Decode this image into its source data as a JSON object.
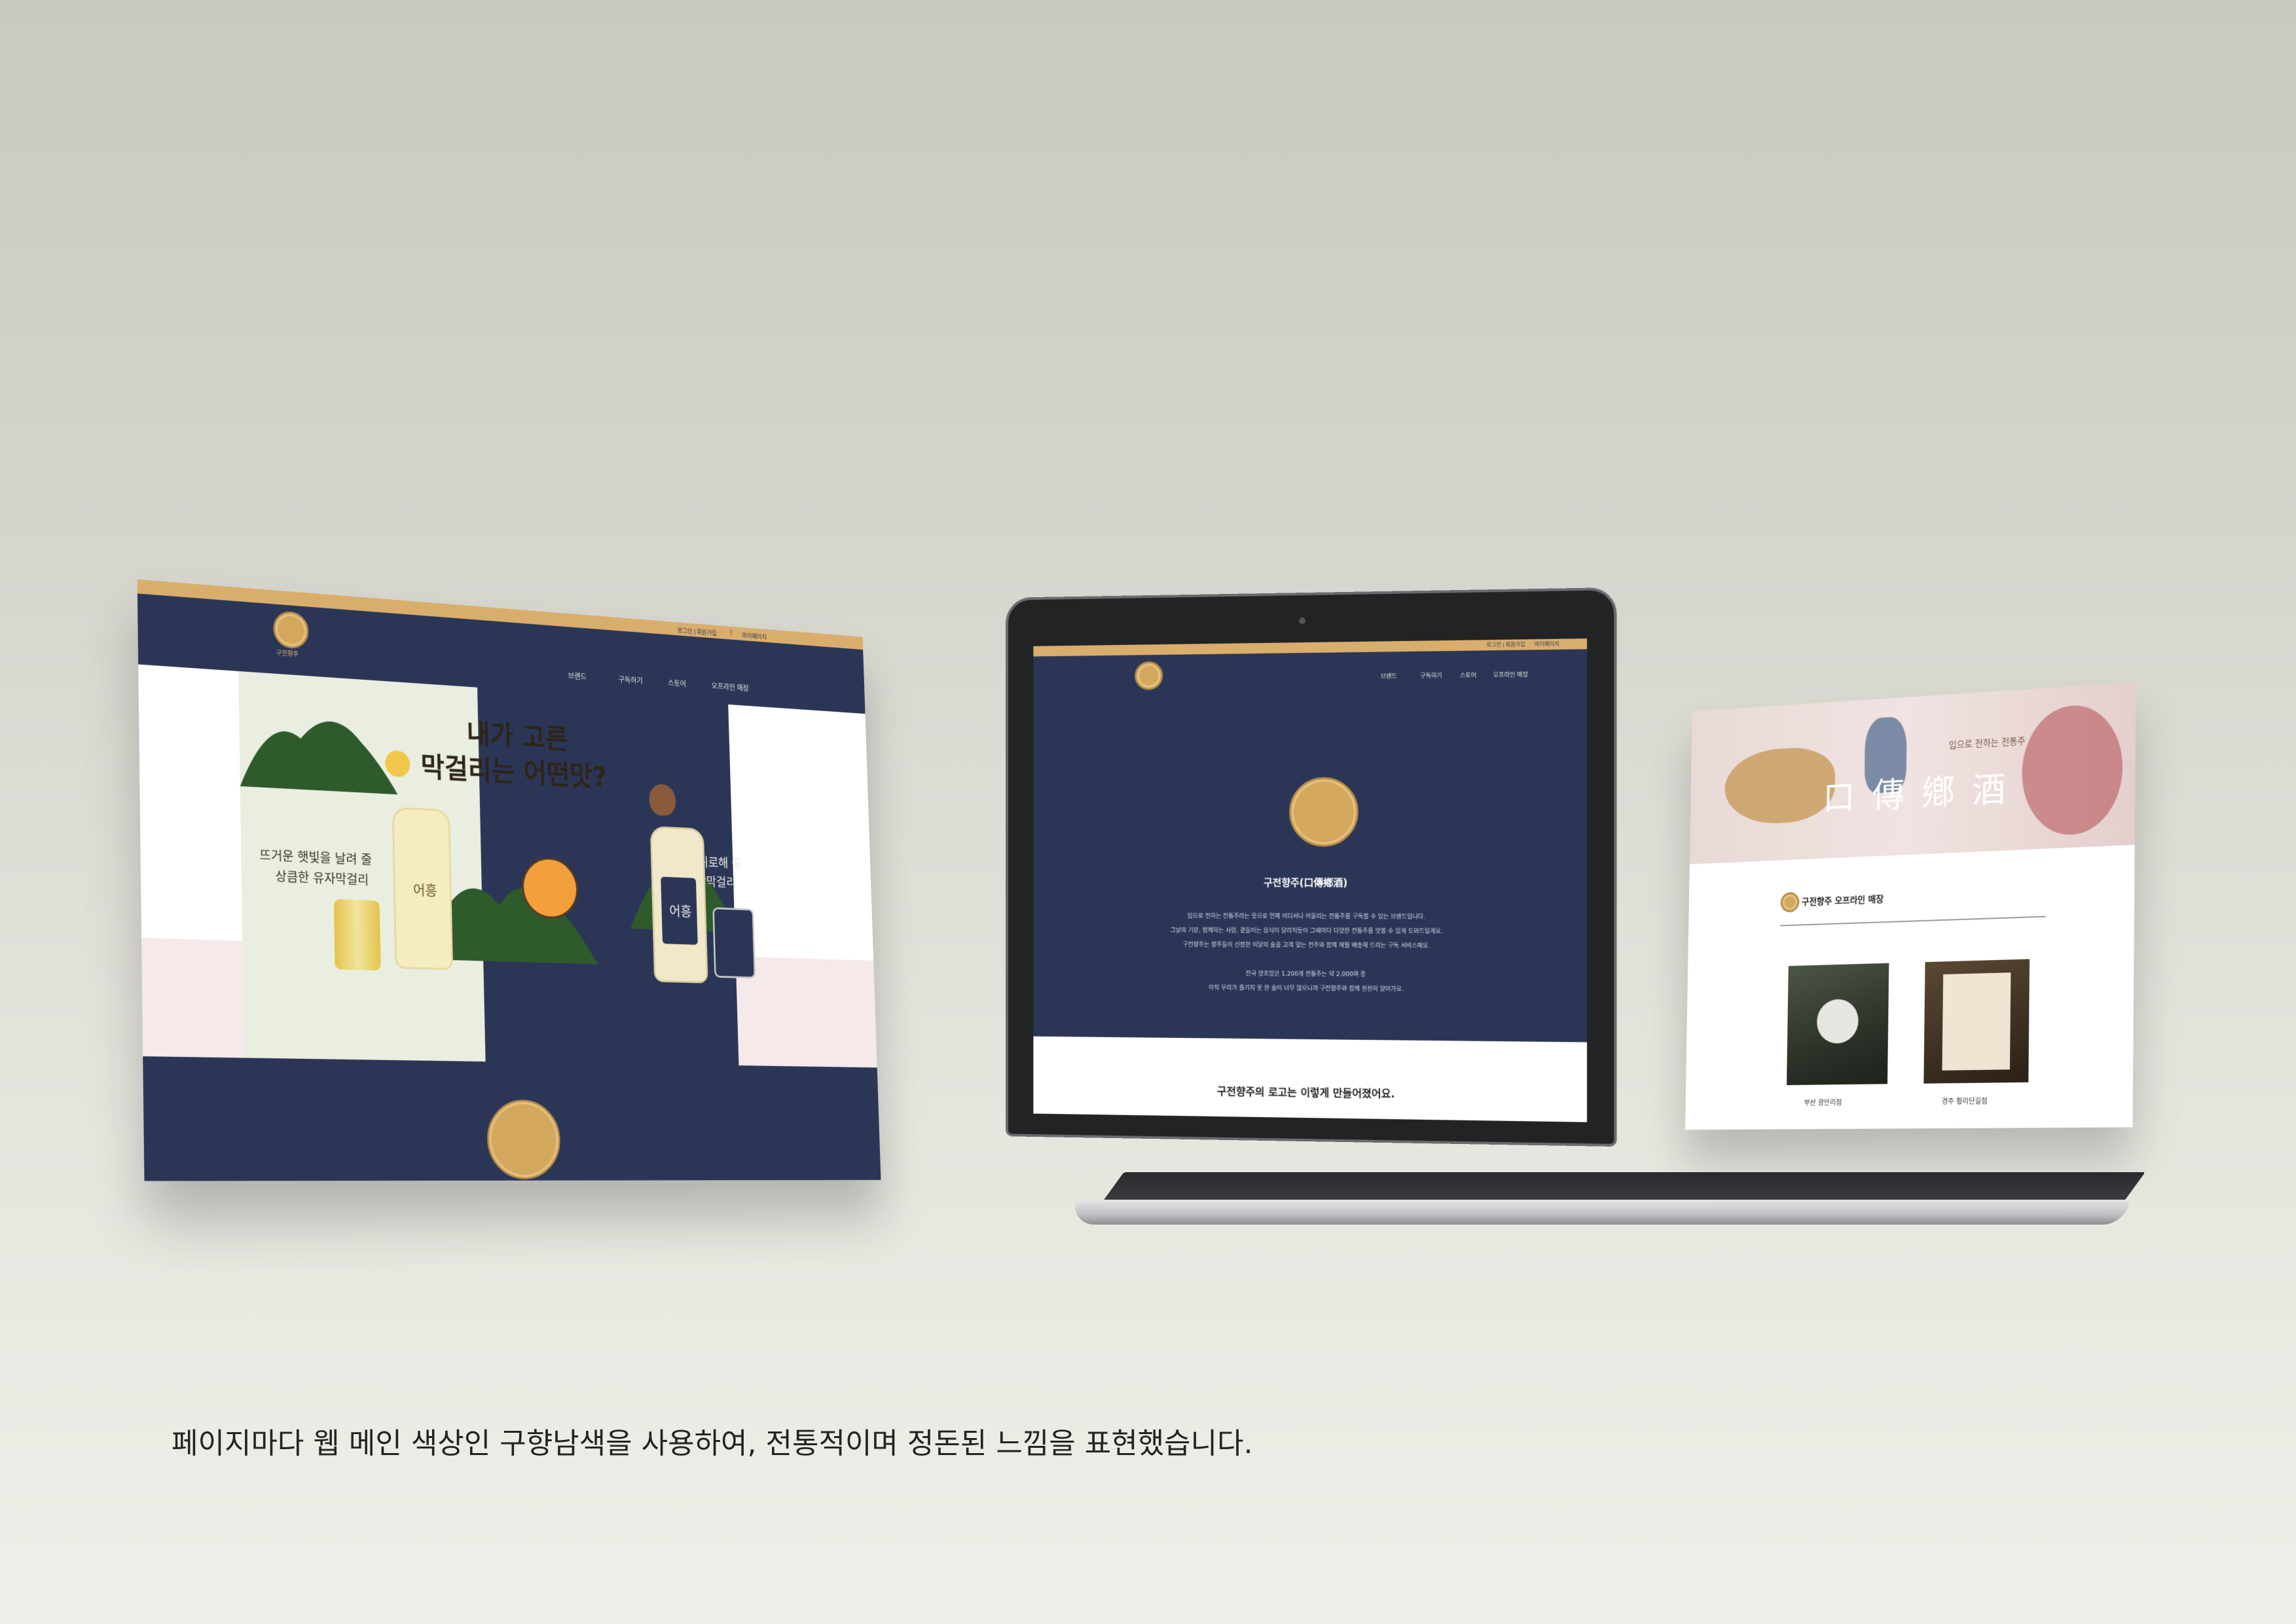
{
  "left_site": {
    "topbar_links": [
      "로그인 | 회원가입",
      "|",
      "마이페이지"
    ],
    "logo_text": "구전향주",
    "nav": [
      "브랜드",
      "구독하기",
      "스토어",
      "오프라인 매장"
    ],
    "headline_line1": "내가 고른",
    "headline_line2": "막걸리는 어떤맛?",
    "left_copy_line1": "뜨거운 햇빛을 날려 줄",
    "left_copy_line2": "상큼한 유자막걸리",
    "right_copy_line1": "지친 밤을 위로해 줄",
    "right_copy_line2": "달달한 밤막걸리",
    "brand_word": "어흥",
    "bottle_label": "어흥"
  },
  "laptop_site": {
    "topbar_links": [
      "로그인 | 회원가입",
      "마이페이지"
    ],
    "nav": [
      "브랜드",
      "구독하기",
      "스토어",
      "오프라인 매장"
    ],
    "title": "구전향주(口傳鄕酒)",
    "body_lines": [
      "입으로 전하는 전통주라는 뜻으로 언제 어디서나 어울리는 전통주를 구독할 수 있는 브랜드입니다.",
      "그날의 기분, 함께하는 사람, 곁들이는 음식이 달라지듯이 그때마다 다양한 전통주를 맛볼 수 있게 도와드릴게요.",
      "구전향주는 향주들이 선정한 이달의 술을 고객 맞는 전주와 함께 매월 배송해 드리는 구독 서비스예요."
    ],
    "body_lines2": [
      "전국 양조장은 1,200개 전통주는 약 2,000여 종",
      "아직 우리가 즐기지 못 한 술이 너무 많으니까 구전향주와 함께 천천히 알아가요."
    ],
    "footer_heading": "구전향주의 로고는 이렇게 만들어졌어요."
  },
  "right_site": {
    "banner_title": "口 傳 鄕 酒",
    "banner_sub": "입으로 전하는 전통주",
    "section_title": "구전향주 오프라인 매장",
    "stores": [
      "부산 광안리점",
      "경주 황리단길점"
    ]
  },
  "caption": "페이지마다 웹 메인 색상인 구향남색을 사용하여, 전통적이며 정돈된 느낌을 표현했습니다.",
  "colors": {
    "navy": "#2b3657",
    "gold": "#d9ae6c",
    "forest": "#2f5a2c",
    "pink": "#f6e9ea"
  }
}
